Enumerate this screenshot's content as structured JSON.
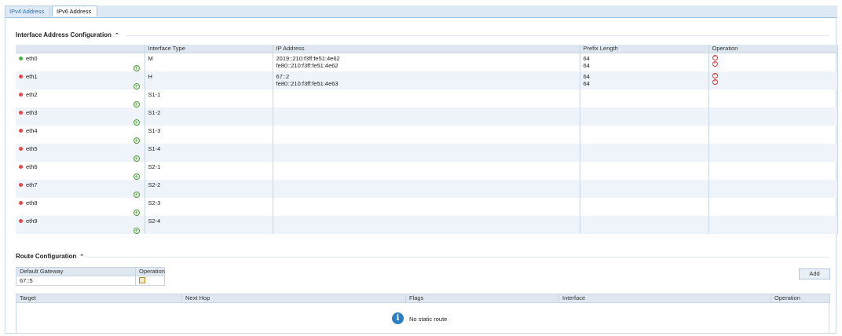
{
  "tabs": [
    {
      "label": "IPv4 Address"
    },
    {
      "label": "IPv6 Address"
    }
  ],
  "interface_section": {
    "title": "Interface Address Configuration",
    "columns": {
      "interface_type": "Interface Type",
      "ip_address": "IP Address",
      "prefix_length": "Prefix Length",
      "operation": "Operation"
    },
    "rows": [
      {
        "name": "eth0",
        "status": "up",
        "type": "M",
        "ip1": "2019::210:f3ff:fe51:4e62",
        "ip2": "fe80::210:f3ff:fe51:4e62",
        "prefix1": "64",
        "prefix2": "64"
      },
      {
        "name": "eth1",
        "status": "down",
        "type": "H",
        "ip1": "67::2",
        "ip2": "fe80::210:f3ff:fe51:4e63",
        "prefix1": "64",
        "prefix2": "64"
      },
      {
        "name": "eth2",
        "status": "down",
        "type": "S1-1"
      },
      {
        "name": "eth3",
        "status": "down",
        "type": "S1-2"
      },
      {
        "name": "eth4",
        "status": "down",
        "type": "S1-3"
      },
      {
        "name": "eth5",
        "status": "down",
        "type": "S1-4"
      },
      {
        "name": "eth6",
        "status": "down",
        "type": "S2-1"
      },
      {
        "name": "eth7",
        "status": "down",
        "type": "S2-2"
      },
      {
        "name": "eth8",
        "status": "down",
        "type": "S2-3"
      },
      {
        "name": "eth9",
        "status": "down",
        "type": "S2-4"
      }
    ]
  },
  "route_section": {
    "title": "Route Configuration",
    "gateway_header": "Default Gateway",
    "gateway_operation_header": "Operation",
    "gateway_value": "67::5",
    "add_label": "Add",
    "columns": {
      "target": "Target",
      "next_hop": "Next Hop",
      "flags": "Flags",
      "interface": "Interface",
      "operation": "Operation"
    },
    "empty_message": "No static route"
  },
  "colors": {
    "status_up": "#4caf50",
    "status_down": "#e24a4a",
    "info": "#2b7fc2"
  }
}
